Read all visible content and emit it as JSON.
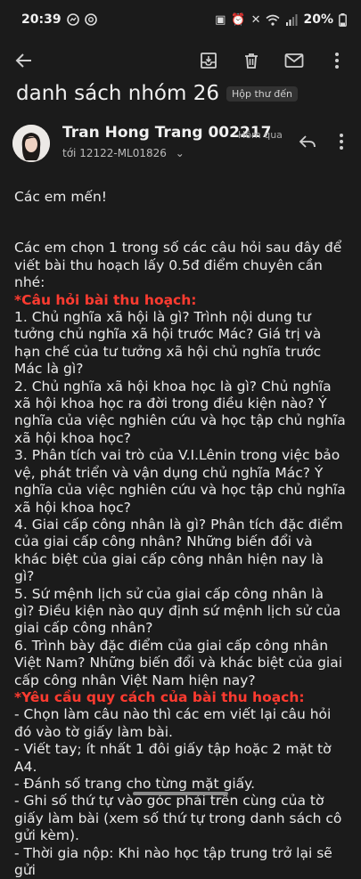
{
  "status_bar": {
    "time": "20:39",
    "battery": "20%",
    "icons": [
      "messenger-icon",
      "at-icon",
      "lock-icon",
      "alarm-icon",
      "mute-icon",
      "wifi-icon",
      "signal-icon",
      "battery-icon"
    ]
  },
  "toolbar": {
    "back_icon": "arrow-left-icon",
    "actions": [
      "archive-icon",
      "delete-icon",
      "mark-unread-icon",
      "more-vert-icon"
    ]
  },
  "email": {
    "subject": "danh sách nhóm 26",
    "label": "Hộp thư đến",
    "sender_name": "Tran Hong Trang 002217",
    "time": "Hôm qua",
    "recipient": "tới 12122-ML01826",
    "body": {
      "greeting": "Các em mến!",
      "intro": "Các em chọn 1 trong số các câu hỏi sau đây để viết bài thu hoạch lấy 0.5đ điểm chuyên cần nhé:",
      "questions_heading": "*Câu hỏi bài thu hoạch:",
      "questions": [
        "1. Chủ nghĩa xã hội là gì? Trình nội dung tư tưởng chủ nghĩa xã hội trước Mác? Giá trị và hạn chế của tư tưởng xã hội chủ nghĩa trước Mác là gì?",
        "2. Chủ nghĩa xã hội khoa học là gì? Chủ nghĩa xã hội khoa học ra đời trong điều kiện nào? Ý nghĩa của việc nghiên cứu và học tập chủ nghĩa xã hội khoa học?",
        "3. Phân tích vai trò của V.I.Lênin trong việc bảo vệ, phát triển và vận dụng chủ nghĩa Mác? Ý nghĩa của việc nghiên cứu và học tập chủ nghĩa xã hội khoa học?",
        "4. Giai cấp công nhân là gì? Phân tích đặc điểm của giai cấp công nhân? Những biến đổi và khác biệt của giai cấp công nhân hiện nay là gì?",
        "5. Sứ mệnh lịch sử của giai cấp công nhân là gì? Điều kiện nào quy định sứ mệnh lịch sử của giai cấp công nhân?",
        "6. Trình bày đặc điểm của giai cấp công nhân Việt Nam? Những biến đổi và khác biệt của giai cấp công nhân Việt Nam hiện nay?"
      ],
      "requirements_heading": "*Yêu cầu quy cách của bài thu hoạch:",
      "requirements": [
        "- Chọn làm câu nào thì các em viết lại câu hỏi đó vào tờ giấy làm bài.",
        "- Viết tay; ít nhất 1 đôi giấy tập hoặc 2 mặt tờ A4.",
        "- Đánh số trang cho từng mặt giấy.",
        "- Ghi số thứ tự vào góc phải trên cùng của tờ giấy làm bài (xem số thứ tự trong danh sách cô gửi kèm).",
        "- Thời gia nộp: Khi nào học tập trung trở lại sẽ gửi"
      ]
    }
  },
  "colors": {
    "background": "#1b1b1b",
    "text": "#e9e9e9",
    "emphasis": "#ff3b30"
  }
}
